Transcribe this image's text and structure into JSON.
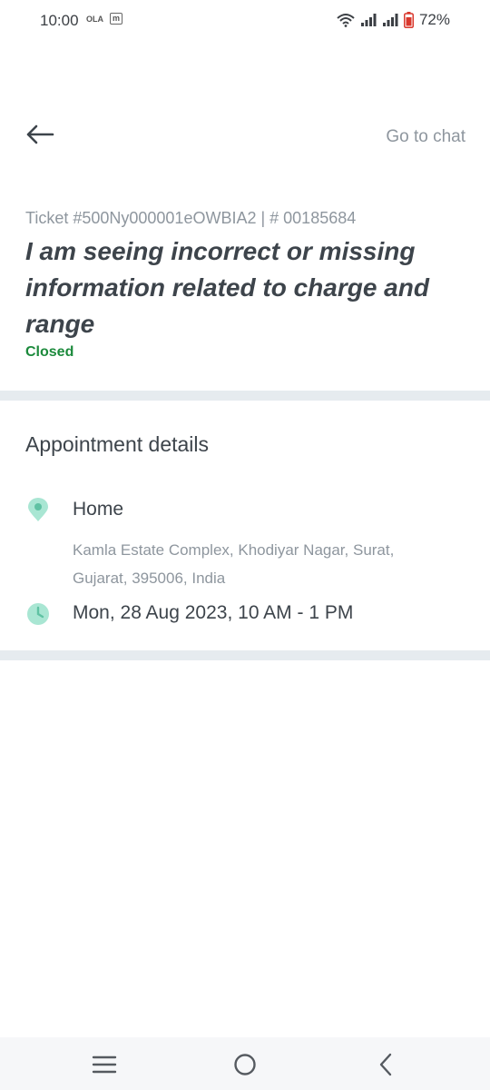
{
  "status_bar": {
    "time": "10:00",
    "app_icons": [
      "OLA",
      "m"
    ],
    "battery": "72%"
  },
  "header": {
    "go_to_chat": "Go to chat"
  },
  "ticket": {
    "id_line": "Ticket #500Ny000001eOWBIA2 | # 00185684",
    "title": "I am seeing incorrect or missing information related to charge and range",
    "status": "Closed",
    "status_color": "#1c8a3c"
  },
  "appointment": {
    "section_title": "Appointment details",
    "location_label": "Home",
    "address": "Kamla Estate Complex, Khodiyar Nagar, Surat, Gujarat, 395006, India",
    "datetime": "Mon, 28 Aug 2023, 10 AM - 1 PM",
    "icon_color": "#a9e6d3"
  },
  "icons": {
    "back": "arrow-left-icon",
    "location": "location-pin-icon",
    "time": "clock-icon",
    "nav_menu": "menu-icon",
    "nav_home": "home-circle-icon",
    "nav_back": "chevron-left-icon"
  }
}
